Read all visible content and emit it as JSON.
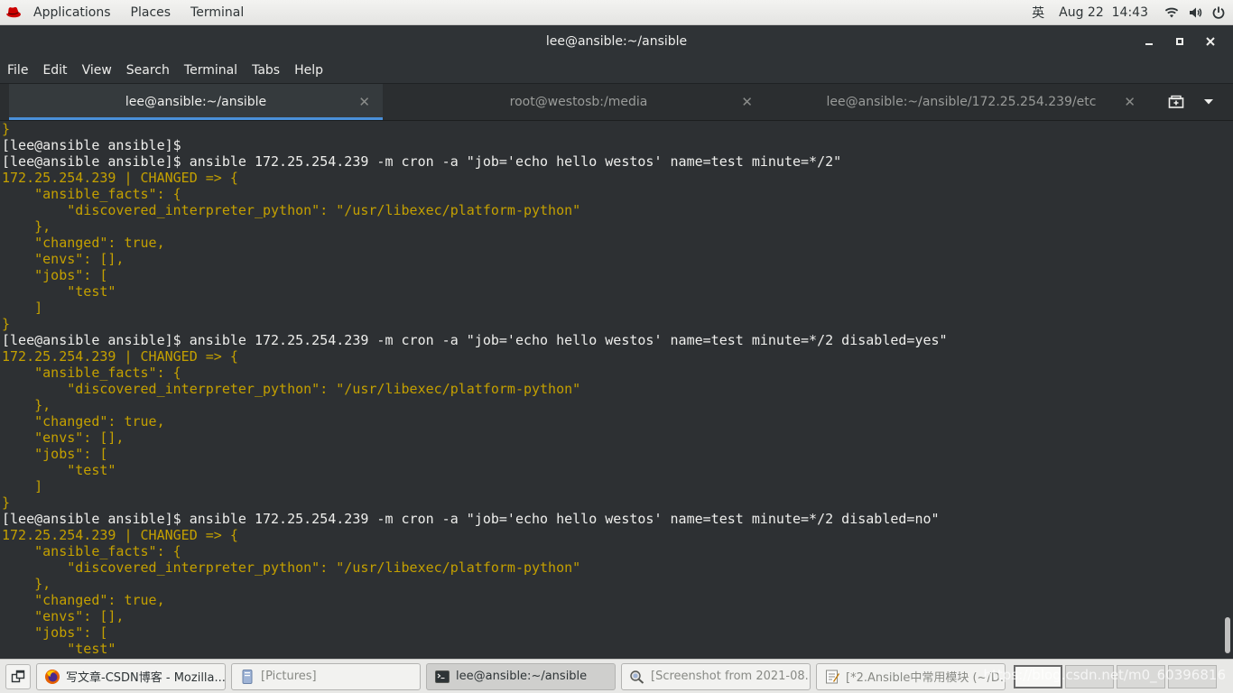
{
  "topbar": {
    "applications": "Applications",
    "places": "Places",
    "terminal": "Terminal",
    "input_method": "英",
    "date": "Aug 22",
    "time": "14:43"
  },
  "window": {
    "title": "lee@ansible:~/ansible"
  },
  "menubar": [
    "File",
    "Edit",
    "View",
    "Search",
    "Terminal",
    "Tabs",
    "Help"
  ],
  "tabs": [
    {
      "label": "lee@ansible:~/ansible",
      "active": true
    },
    {
      "label": "root@westosb:/media",
      "active": false
    },
    {
      "label": "lee@ansible:~/ansible/172.25.254.239/etc",
      "active": false
    }
  ],
  "terminal": {
    "lines": [
      {
        "text": "}",
        "kind": "out"
      },
      {
        "text": "[lee@ansible ansible]$",
        "kind": "prompt"
      },
      {
        "text": "[lee@ansible ansible]$ ansible 172.25.254.239 -m cron -a \"job='echo hello westos' name=test minute=*/2\"",
        "kind": "prompt"
      },
      {
        "text": "172.25.254.239 | CHANGED => {",
        "kind": "out"
      },
      {
        "text": "    \"ansible_facts\": {",
        "kind": "out"
      },
      {
        "text": "        \"discovered_interpreter_python\": \"/usr/libexec/platform-python\"",
        "kind": "out"
      },
      {
        "text": "    },",
        "kind": "out"
      },
      {
        "text": "    \"changed\": true,",
        "kind": "out"
      },
      {
        "text": "    \"envs\": [],",
        "kind": "out"
      },
      {
        "text": "    \"jobs\": [",
        "kind": "out"
      },
      {
        "text": "        \"test\"",
        "kind": "out"
      },
      {
        "text": "    ]",
        "kind": "out"
      },
      {
        "text": "}",
        "kind": "out"
      },
      {
        "text": "[lee@ansible ansible]$ ansible 172.25.254.239 -m cron -a \"job='echo hello westos' name=test minute=*/2 disabled=yes\"",
        "kind": "prompt"
      },
      {
        "text": "172.25.254.239 | CHANGED => {",
        "kind": "out"
      },
      {
        "text": "    \"ansible_facts\": {",
        "kind": "out"
      },
      {
        "text": "        \"discovered_interpreter_python\": \"/usr/libexec/platform-python\"",
        "kind": "out"
      },
      {
        "text": "    },",
        "kind": "out"
      },
      {
        "text": "    \"changed\": true,",
        "kind": "out"
      },
      {
        "text": "    \"envs\": [],",
        "kind": "out"
      },
      {
        "text": "    \"jobs\": [",
        "kind": "out"
      },
      {
        "text": "        \"test\"",
        "kind": "out"
      },
      {
        "text": "    ]",
        "kind": "out"
      },
      {
        "text": "}",
        "kind": "out"
      },
      {
        "text": "[lee@ansible ansible]$ ansible 172.25.254.239 -m cron -a \"job='echo hello westos' name=test minute=*/2 disabled=no\"",
        "kind": "prompt"
      },
      {
        "text": "172.25.254.239 | CHANGED => {",
        "kind": "out"
      },
      {
        "text": "    \"ansible_facts\": {",
        "kind": "out"
      },
      {
        "text": "        \"discovered_interpreter_python\": \"/usr/libexec/platform-python\"",
        "kind": "out"
      },
      {
        "text": "    },",
        "kind": "out"
      },
      {
        "text": "    \"changed\": true,",
        "kind": "out"
      },
      {
        "text": "    \"envs\": [],",
        "kind": "out"
      },
      {
        "text": "    \"jobs\": [",
        "kind": "out"
      },
      {
        "text": "        \"test\"",
        "kind": "out"
      }
    ],
    "colors": {
      "output": "#c4a000",
      "prompt": "#eeeeec",
      "background": "#2d3033"
    }
  },
  "taskbar": {
    "tasks": [
      {
        "label": "写文章-CSDN博客 - Mozilla...",
        "icon": "firefox-icon",
        "state": "normal"
      },
      {
        "label": "[Pictures]",
        "icon": "file-manager-icon",
        "state": "minimized"
      },
      {
        "label": "lee@ansible:~/ansible",
        "icon": "terminal-icon",
        "state": "active"
      },
      {
        "label": "[Screenshot from 2021-08...",
        "icon": "image-viewer-icon",
        "state": "minimized"
      },
      {
        "label": "[*2.Ansible中常用模块 (~/D...",
        "icon": "text-editor-icon",
        "state": "minimized"
      }
    ],
    "watermark": "https://blog.csdn.net/m0_60396816"
  }
}
